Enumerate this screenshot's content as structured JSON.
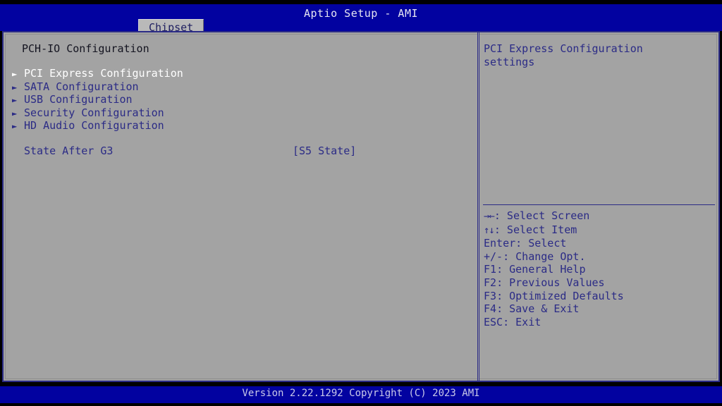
{
  "header": {
    "app_title": "Aptio Setup - AMI",
    "tabs": [
      {
        "label": "Chipset",
        "active": true
      }
    ]
  },
  "main": {
    "section_title": "PCH-IO Configuration",
    "menu_items": [
      {
        "label": "PCI Express Configuration",
        "arrow": "submenu-arrow-icon",
        "selected": true
      },
      {
        "label": "SATA Configuration",
        "arrow": "submenu-arrow-icon",
        "selected": false
      },
      {
        "label": "USB Configuration",
        "arrow": "submenu-arrow-icon",
        "selected": false
      },
      {
        "label": "Security Configuration",
        "arrow": "submenu-arrow-icon",
        "selected": false
      },
      {
        "label": "HD Audio Configuration",
        "arrow": "submenu-arrow-icon",
        "selected": false
      }
    ],
    "option": {
      "label": "State After G3",
      "value": "[S5 State]"
    }
  },
  "help": {
    "text": "PCI Express Configuration settings",
    "legend": [
      {
        "keys": "→←",
        "separator": ": ",
        "action": "Select Screen"
      },
      {
        "keys": "↑↓",
        "separator": ": ",
        "action": "Select Item"
      },
      {
        "keys": "Enter",
        "separator": ": ",
        "action": "Select"
      },
      {
        "keys": "+/-",
        "separator": ": ",
        "action": "Change Opt."
      },
      {
        "keys": "F1",
        "separator": ": ",
        "action": "General Help"
      },
      {
        "keys": "F2",
        "separator": ": ",
        "action": "Previous Values"
      },
      {
        "keys": "F3",
        "separator": ": ",
        "action": "Optimized Defaults"
      },
      {
        "keys": "F4",
        "separator": ": ",
        "action": "Save & Exit"
      },
      {
        "keys": "ESC",
        "separator": ": ",
        "action": "Exit"
      }
    ]
  },
  "footer": {
    "text": "Version 2.22.1292 Copyright (C) 2023 AMI"
  },
  "colors": {
    "panel_background": "#a3a3a3",
    "band_blue": "#0202a0",
    "text_blue": "#2b2b86",
    "selected_text": "#ffffff",
    "tab_background": "#b9b9b9"
  }
}
